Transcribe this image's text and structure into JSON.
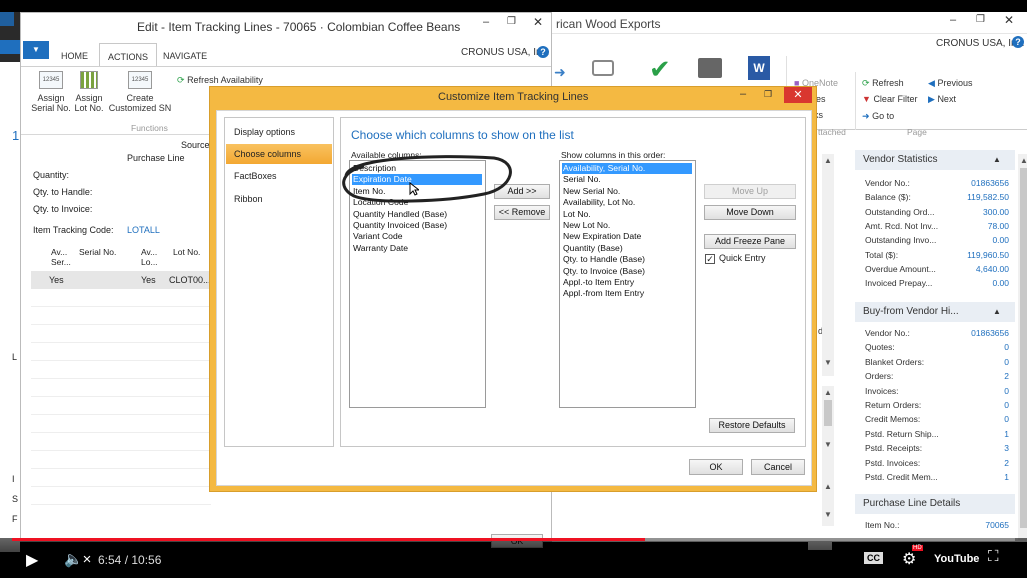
{
  "bg_window": {
    "title_partial": "rican Wood Exports",
    "company": "CRONUS USA, Inc.",
    "ribbon": {
      "onenote": "OneNote",
      "notes": "Notes",
      "links": "ks",
      "attached": "ttached",
      "refresh": "Refresh",
      "clear_filter": "Clear Filter",
      "go_to": "Go to",
      "previous": "Previous",
      "next": "Next",
      "page_group": "Page"
    },
    "side_text": "ds"
  },
  "vendor_statistics": {
    "title": "Vendor Statistics",
    "rows": [
      {
        "label": "Vendor No.:",
        "value": "01863656"
      },
      {
        "label": "Balance ($):",
        "value": "119,582.50"
      },
      {
        "label": "Outstanding Ord...",
        "value": "300.00"
      },
      {
        "label": "Amt. Rcd. Not Inv...",
        "value": "78.00"
      },
      {
        "label": "Outstanding Invo...",
        "value": "0.00"
      },
      {
        "label": "Total ($):",
        "value": "119,960.50"
      },
      {
        "label": "Overdue Amount...",
        "value": "4,640.00"
      },
      {
        "label": "Invoiced Prepay...",
        "value": "0.00"
      }
    ]
  },
  "buy_from_history": {
    "title": "Buy-from Vendor Hi...",
    "rows": [
      {
        "label": "Vendor No.:",
        "value": "01863656"
      },
      {
        "label": "Quotes:",
        "value": "0"
      },
      {
        "label": "Blanket Orders:",
        "value": "0"
      },
      {
        "label": "Orders:",
        "value": "2"
      },
      {
        "label": "Invoices:",
        "value": "0"
      },
      {
        "label": "Return Orders:",
        "value": "0"
      },
      {
        "label": "Credit Memos:",
        "value": "0"
      },
      {
        "label": "Pstd. Return Ship...",
        "value": "1"
      },
      {
        "label": "Pstd. Receipts:",
        "value": "3"
      },
      {
        "label": "Pstd. Invoices:",
        "value": "2"
      },
      {
        "label": "Pstd. Credit Mem...",
        "value": "1"
      }
    ]
  },
  "purchase_line_details": {
    "title": "Purchase Line Details",
    "rows": [
      {
        "label": "Item No.:",
        "value": "70065"
      }
    ]
  },
  "edit_window": {
    "title": "Edit - Item Tracking Lines - 70065 · Colombian Coffee Beans",
    "company": "CRONUS USA, Inc.",
    "tabs": [
      "HOME",
      "ACTIONS",
      "NAVIGATE"
    ],
    "ribbon": {
      "assign_serial": "Assign Serial No.",
      "assign_lot": "Assign Lot No.",
      "create_sn": "Create Customized SN",
      "refresh_availability": "Refresh Availability",
      "functions_group": "Functions",
      "icon_text": "12345"
    },
    "source_label": "Source",
    "source_value": "Purchase Line",
    "quantity_label": "Quantity:",
    "qty_to_handle_label": "Qty. to Handle:",
    "qty_to_invoice_label": "Qty. to Invoice:",
    "tracking_code_label": "Item Tracking Code:",
    "tracking_code_value": "LOTALL",
    "grid_headers": [
      "Av... Ser...",
      "Serial No.",
      "Av... Lo...",
      "Lot No."
    ],
    "grid_row": [
      "Yes",
      "",
      "Yes",
      "CLOT00..."
    ],
    "ok_label": "OK"
  },
  "dialog": {
    "title": "Customize Item Tracking Lines",
    "nav": [
      "Display options",
      "Choose columns",
      "FactBoxes",
      "Ribbon"
    ],
    "heading": "Choose which columns to show on the list",
    "available_label": "Available columns:",
    "available": [
      "Description",
      "Expiration Date",
      "Item No.",
      "Location Code",
      "Quantity Handled (Base)",
      "Quantity Invoiced (Base)",
      "Variant Code",
      "Warranty Date"
    ],
    "show_label": "Show columns in this order:",
    "shown": [
      "Availability, Serial No.",
      "Serial No.",
      "New Serial No.",
      "Availability, Lot No.",
      "Lot No.",
      "New Lot No.",
      "New Expiration Date",
      "Quantity (Base)",
      "Qty. to Handle (Base)",
      "Qty. to Invoice (Base)",
      "Appl.-to Item Entry",
      "Appl.-from Item Entry"
    ],
    "add_button": "Add >>",
    "remove_button": "<< Remove",
    "move_up": "Move Up",
    "move_down": "Move Down",
    "add_freeze": "Add Freeze Pane",
    "quick_entry": "Quick Entry",
    "restore_defaults": "Restore Defaults",
    "ok": "OK",
    "cancel": "Cancel"
  },
  "video": {
    "time": "6:54 / 10:56",
    "progress": 0.631,
    "cc": "CC",
    "hd": "HD",
    "youtube": "YouTube"
  },
  "colors": {
    "accent_blue": "#1f6fbe",
    "dialog_orange": "#f4b942",
    "selection_blue": "#3399ff",
    "progress_red": "#e12"
  }
}
